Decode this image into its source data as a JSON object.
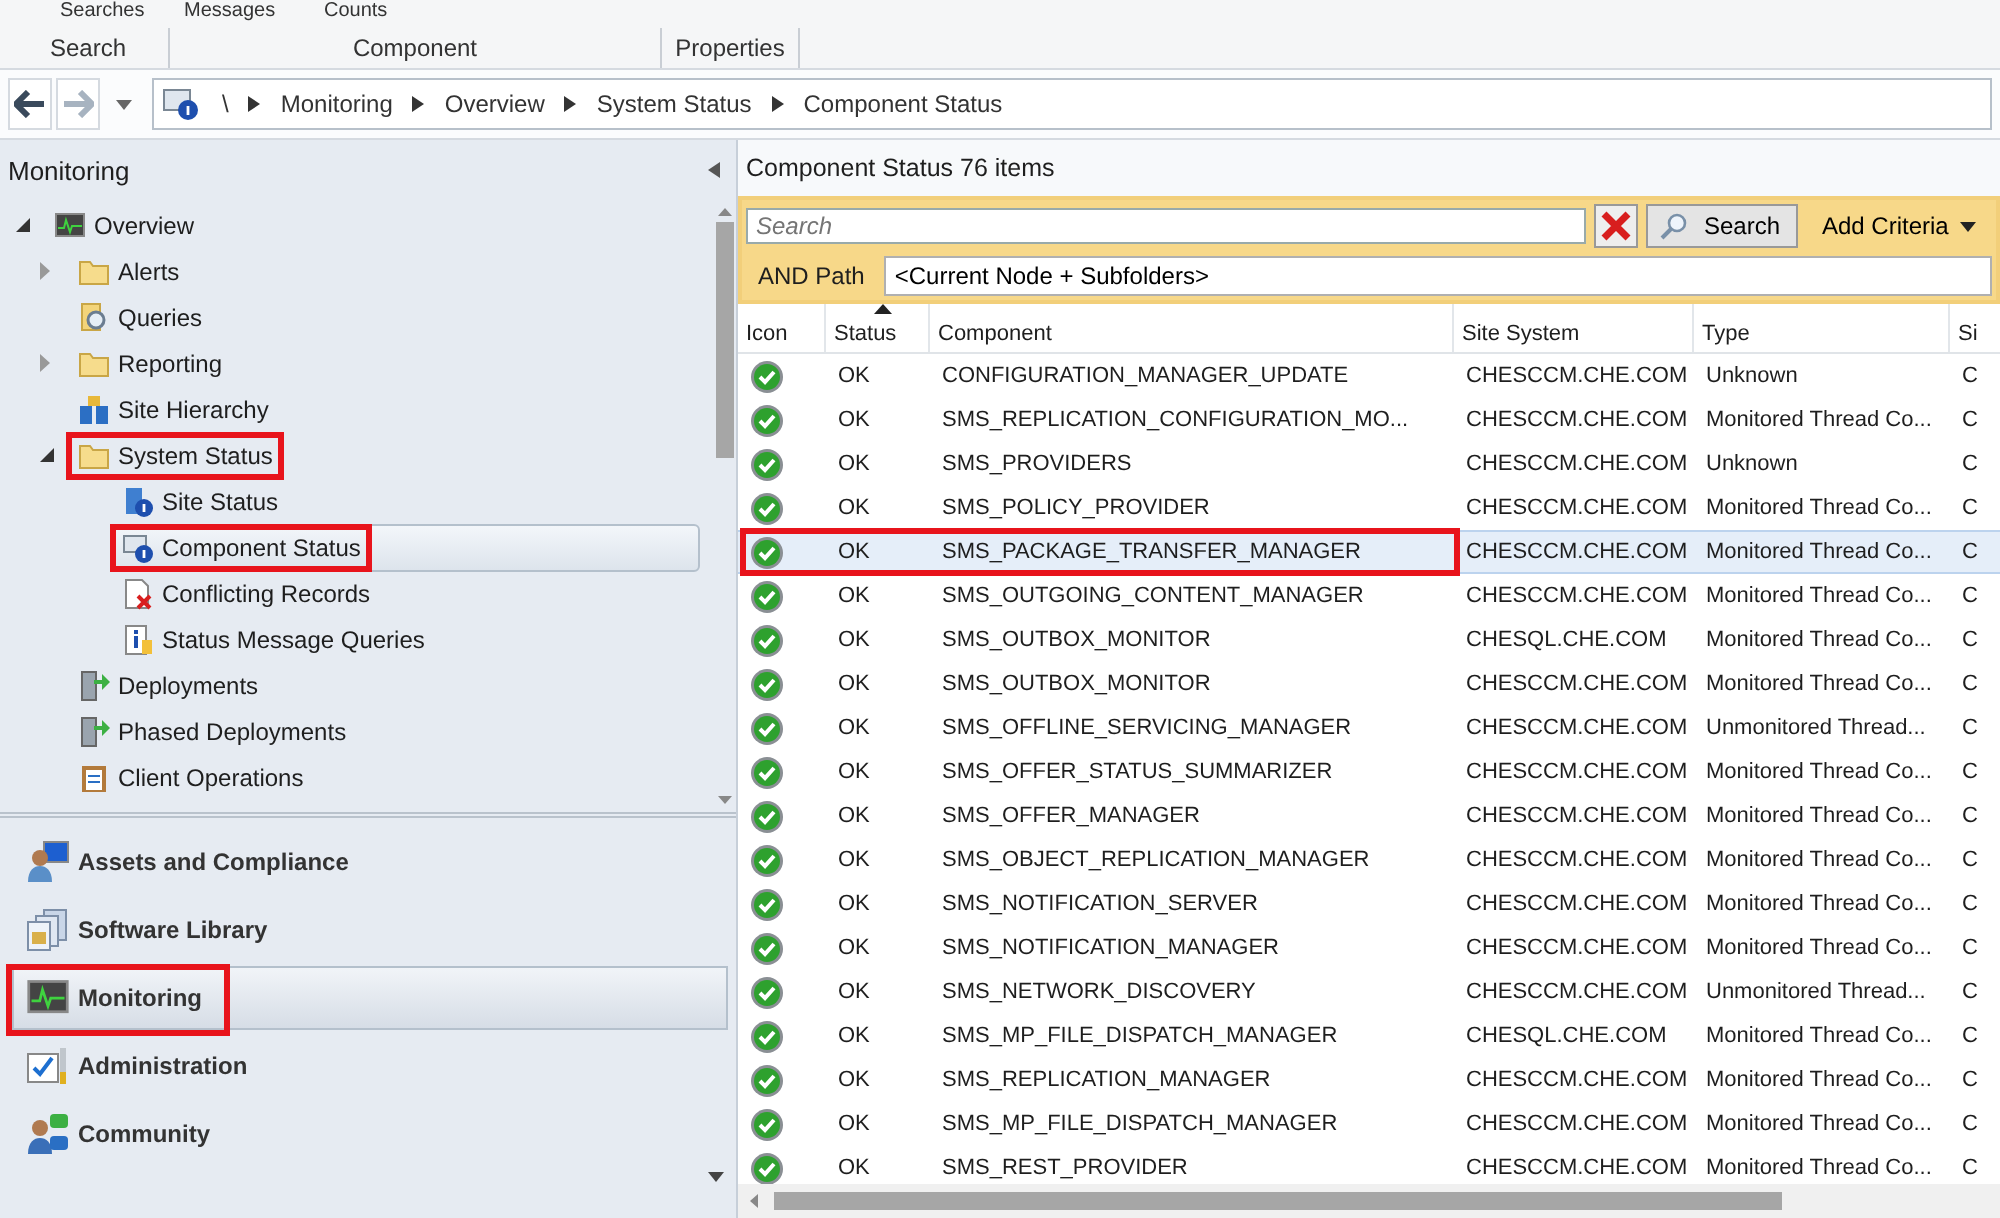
{
  "ribbon": {
    "commands": [
      "Searches",
      "Messages",
      "Counts"
    ],
    "groups": [
      "Search",
      "Component",
      "Properties"
    ]
  },
  "address_bar": {
    "path": [
      "\\",
      "Monitoring",
      "Overview",
      "System Status",
      "Component Status"
    ]
  },
  "navigation": {
    "title": "Monitoring",
    "tree": [
      {
        "label": "Overview",
        "expanded": true,
        "selected": false,
        "highlighted": false,
        "children": [
          {
            "label": "Alerts",
            "expanded": false,
            "selected": false,
            "highlighted": false
          },
          {
            "label": "Queries",
            "selected": false,
            "highlighted": false
          },
          {
            "label": "Reporting",
            "expanded": false,
            "selected": false,
            "highlighted": false
          },
          {
            "label": "Site Hierarchy",
            "selected": false,
            "highlighted": false
          },
          {
            "label": "System Status",
            "expanded": true,
            "selected": false,
            "highlighted": true,
            "children": [
              {
                "label": "Site Status",
                "selected": false,
                "highlighted": false
              },
              {
                "label": "Component Status",
                "selected": true,
                "highlighted": true
              },
              {
                "label": "Conflicting Records",
                "selected": false,
                "highlighted": false
              },
              {
                "label": "Status Message Queries",
                "selected": false,
                "highlighted": false
              }
            ]
          },
          {
            "label": "Deployments",
            "selected": false,
            "highlighted": false
          },
          {
            "label": "Phased Deployments",
            "selected": false,
            "highlighted": false
          },
          {
            "label": "Client Operations",
            "selected": false,
            "highlighted": false
          }
        ]
      }
    ],
    "workspaces": [
      {
        "label": "Assets and Compliance",
        "selected": false,
        "highlighted": false
      },
      {
        "label": "Software Library",
        "selected": false,
        "highlighted": false
      },
      {
        "label": "Monitoring",
        "selected": true,
        "highlighted": true
      },
      {
        "label": "Administration",
        "selected": false,
        "highlighted": false
      },
      {
        "label": "Community",
        "selected": false,
        "highlighted": false
      }
    ]
  },
  "results": {
    "title": "Component Status",
    "count": "76 items",
    "search": {
      "placeholder": "Search",
      "button": "Search",
      "add_criteria": "Add Criteria",
      "path_label": "AND Path",
      "path_value": "<Current Node + Subfolders>"
    },
    "columns": [
      {
        "label": "Icon",
        "sorted": false
      },
      {
        "label": "Status",
        "sorted": true
      },
      {
        "label": "Component",
        "sorted": false
      },
      {
        "label": "Site System",
        "sorted": false
      },
      {
        "label": "Type",
        "sorted": false
      },
      {
        "label": "Si",
        "sorted": false
      }
    ],
    "rows": [
      {
        "status": "OK",
        "component": "CONFIGURATION_MANAGER_UPDATE",
        "site_system": "CHESCCM.CHE.COM",
        "type": "Unknown",
        "column_6": "C",
        "selected": false,
        "highlighted": false
      },
      {
        "status": "OK",
        "component": "SMS_REPLICATION_CONFIGURATION_MO...",
        "site_system": "CHESCCM.CHE.COM",
        "type": "Monitored Thread Co...",
        "column_6": "C",
        "selected": false,
        "highlighted": false
      },
      {
        "status": "OK",
        "component": "SMS_PROVIDERS",
        "site_system": "CHESCCM.CHE.COM",
        "type": "Unknown",
        "column_6": "C",
        "selected": false,
        "highlighted": false
      },
      {
        "status": "OK",
        "component": "SMS_POLICY_PROVIDER",
        "site_system": "CHESCCM.CHE.COM",
        "type": "Monitored Thread Co...",
        "column_6": "C",
        "selected": false,
        "highlighted": false
      },
      {
        "status": "OK",
        "component": "SMS_PACKAGE_TRANSFER_MANAGER",
        "site_system": "CHESCCM.CHE.COM",
        "type": "Monitored Thread Co...",
        "column_6": "C",
        "selected": true,
        "highlighted": true
      },
      {
        "status": "OK",
        "component": "SMS_OUTGOING_CONTENT_MANAGER",
        "site_system": "CHESCCM.CHE.COM",
        "type": "Monitored Thread Co...",
        "column_6": "C",
        "selected": false,
        "highlighted": false
      },
      {
        "status": "OK",
        "component": "SMS_OUTBOX_MONITOR",
        "site_system": "CHESQL.CHE.COM",
        "type": "Monitored Thread Co...",
        "column_6": "C",
        "selected": false,
        "highlighted": false
      },
      {
        "status": "OK",
        "component": "SMS_OUTBOX_MONITOR",
        "site_system": "CHESCCM.CHE.COM",
        "type": "Monitored Thread Co...",
        "column_6": "C",
        "selected": false,
        "highlighted": false
      },
      {
        "status": "OK",
        "component": "SMS_OFFLINE_SERVICING_MANAGER",
        "site_system": "CHESCCM.CHE.COM",
        "type": "Unmonitored Thread...",
        "column_6": "C",
        "selected": false,
        "highlighted": false
      },
      {
        "status": "OK",
        "component": "SMS_OFFER_STATUS_SUMMARIZER",
        "site_system": "CHESCCM.CHE.COM",
        "type": "Monitored Thread Co...",
        "column_6": "C",
        "selected": false,
        "highlighted": false
      },
      {
        "status": "OK",
        "component": "SMS_OFFER_MANAGER",
        "site_system": "CHESCCM.CHE.COM",
        "type": "Monitored Thread Co...",
        "column_6": "C",
        "selected": false,
        "highlighted": false
      },
      {
        "status": "OK",
        "component": "SMS_OBJECT_REPLICATION_MANAGER",
        "site_system": "CHESCCM.CHE.COM",
        "type": "Monitored Thread Co...",
        "column_6": "C",
        "selected": false,
        "highlighted": false
      },
      {
        "status": "OK",
        "component": "SMS_NOTIFICATION_SERVER",
        "site_system": "CHESCCM.CHE.COM",
        "type": "Monitored Thread Co...",
        "column_6": "C",
        "selected": false,
        "highlighted": false
      },
      {
        "status": "OK",
        "component": "SMS_NOTIFICATION_MANAGER",
        "site_system": "CHESCCM.CHE.COM",
        "type": "Monitored Thread Co...",
        "column_6": "C",
        "selected": false,
        "highlighted": false
      },
      {
        "status": "OK",
        "component": "SMS_NETWORK_DISCOVERY",
        "site_system": "CHESCCM.CHE.COM",
        "type": "Unmonitored Thread...",
        "column_6": "C",
        "selected": false,
        "highlighted": false
      },
      {
        "status": "OK",
        "component": "SMS_MP_FILE_DISPATCH_MANAGER",
        "site_system": "CHESQL.CHE.COM",
        "type": "Monitored Thread Co...",
        "column_6": "C",
        "selected": false,
        "highlighted": false
      },
      {
        "status": "OK",
        "component": "SMS_REPLICATION_MANAGER",
        "site_system": "CHESCCM.CHE.COM",
        "type": "Monitored Thread Co...",
        "column_6": "C",
        "selected": false,
        "highlighted": false
      },
      {
        "status": "OK",
        "component": "SMS_MP_FILE_DISPATCH_MANAGER",
        "site_system": "CHESCCM.CHE.COM",
        "type": "Monitored Thread Co...",
        "column_6": "C",
        "selected": false,
        "highlighted": false
      },
      {
        "status": "OK",
        "component": "SMS_REST_PROVIDER",
        "site_system": "CHESCCM.CHE.COM",
        "type": "Monitored Thread Co...",
        "column_6": "C",
        "selected": false,
        "highlighted": false
      }
    ]
  }
}
